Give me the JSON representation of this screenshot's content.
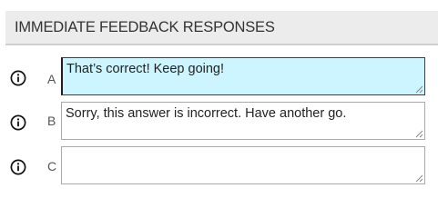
{
  "header": {
    "title": "IMMEDIATE FEEDBACK RESPONSES"
  },
  "rows": [
    {
      "letter": "A",
      "value": "That’s correct! Keep going!",
      "focused": true
    },
    {
      "letter": "B",
      "value": "Sorry, this answer is incorrect. Have another go.",
      "focused": false
    },
    {
      "letter": "C",
      "value": "",
      "focused": false
    }
  ],
  "icons": {
    "info": "info-circle-icon",
    "grip": "resize-grip-icon"
  },
  "colors": {
    "active_field_bg": "#ccf5ff",
    "header_bg": "#ececec"
  }
}
